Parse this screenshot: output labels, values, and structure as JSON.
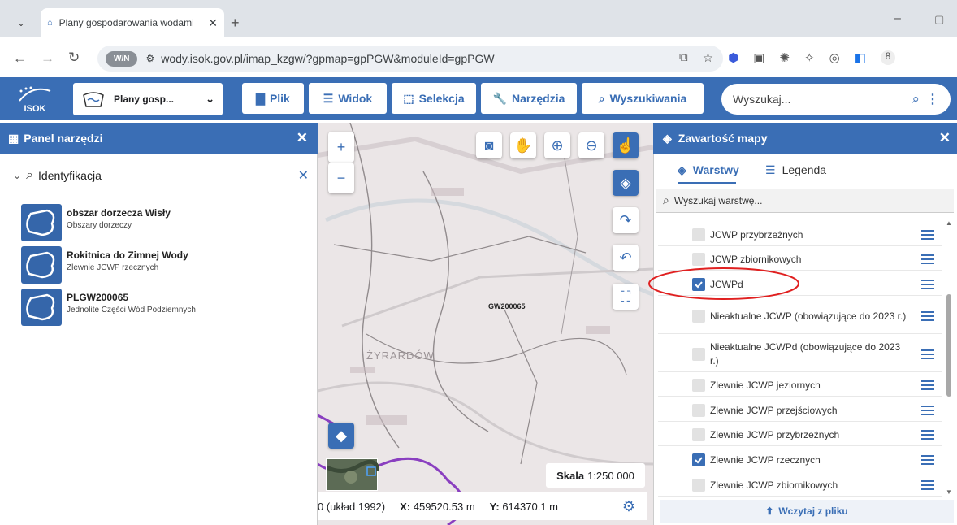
{
  "browser": {
    "tab_title": "Plany gospodarowania wodami",
    "url_scheme_badge": "W/N",
    "url": "wody.isok.gov.pl/imap_kzgw/?gpmap=gpPGW&moduleId=gpPGW",
    "extension_badge": "8"
  },
  "app": {
    "logo_text": "ISOK",
    "map_select_label": "Plany gosp...",
    "menu": [
      "Plik",
      "Widok",
      "Selekcja",
      "Narzędzia",
      "Wyszukiwania"
    ],
    "search_placeholder": "Wyszukaj..."
  },
  "left_panel": {
    "title": "Panel narzędzi",
    "section": "Identyfikacja",
    "results": [
      {
        "name": "obszar dorzecza Wisły",
        "type": "Obszary dorzeczy"
      },
      {
        "name": "Rokitnica do Zimnej Wody",
        "type": "Zlewnie JCWP rzecznych"
      },
      {
        "name": "PLGW200065",
        "type": "Jednolite Części Wód Podziemnych"
      }
    ]
  },
  "map": {
    "feature_label": "GW200065",
    "town_label": "ŻYRARDÓW",
    "scale_label": "Skala",
    "scale_value": "1:250 000",
    "coord_system": "0 (układ 1992)",
    "x_label": "X:",
    "x_value": "459520.53 m",
    "y_label": "Y:",
    "y_value": "614370.1 m"
  },
  "right_panel": {
    "title": "Zawartość mapy",
    "tabs": [
      "Warstwy",
      "Legenda"
    ],
    "layer_search_placeholder": "Wyszukaj warstwę...",
    "layers": [
      {
        "label": "JCWP przybrzeżnych",
        "checked": false
      },
      {
        "label": "JCWP zbiornikowych",
        "checked": false
      },
      {
        "label": "JCWPd",
        "checked": true
      },
      {
        "label": "Nieaktualne JCWP (obowiązujące do 2023 r.)",
        "checked": false
      },
      {
        "label": "Nieaktualne JCWPd (obowiązujące do 2023 r.)",
        "checked": false
      },
      {
        "label": "Zlewnie JCWP jeziornych",
        "checked": false
      },
      {
        "label": "Zlewnie JCWP przejściowych",
        "checked": false
      },
      {
        "label": "Zlewnie JCWP przybrzeżnych",
        "checked": false
      },
      {
        "label": "Zlewnie JCWP rzecznych",
        "checked": true
      },
      {
        "label": "Zlewnie JCWP zbiornikowych",
        "checked": false
      }
    ],
    "load_file_label": "Wczytaj z pliku"
  },
  "colors": {
    "app_blue": "#3a6eb5",
    "highlight_ellipse": "#e02020",
    "river_line": "#8a3fc0"
  }
}
